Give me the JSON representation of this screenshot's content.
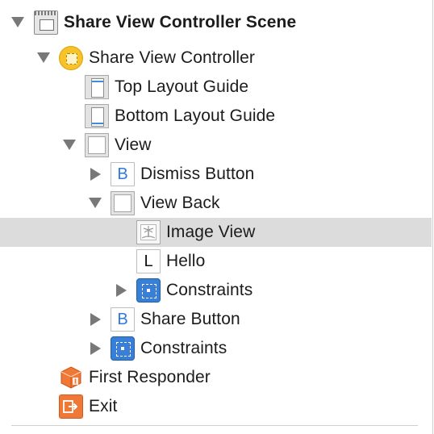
{
  "outline": {
    "scene": {
      "label": "Share View Controller Scene",
      "icon": "storyboard-scene-icon",
      "expanded": true
    },
    "items": [
      {
        "label": "Share View Controller",
        "icon": "view-controller-icon",
        "expanded": true
      },
      {
        "label": "Top Layout Guide",
        "icon": "top-layout-guide-icon"
      },
      {
        "label": "Bottom Layout Guide",
        "icon": "bottom-layout-guide-icon"
      },
      {
        "label": "View",
        "icon": "view-icon",
        "expanded": true
      },
      {
        "label": "Dismiss Button",
        "icon": "button-icon",
        "icon_letter": "B",
        "expanded": false
      },
      {
        "label": "View Back",
        "icon": "view-icon",
        "expanded": true
      },
      {
        "label": "Image View",
        "icon": "image-view-icon",
        "selected": true
      },
      {
        "label": "Hello",
        "icon": "label-icon",
        "icon_letter": "L"
      },
      {
        "label": "Constraints",
        "icon": "constraints-icon",
        "expanded": false
      },
      {
        "label": "Share Button",
        "icon": "button-icon",
        "icon_letter": "B",
        "expanded": false
      },
      {
        "label": "Constraints",
        "icon": "constraints-icon",
        "expanded": false
      },
      {
        "label": "First Responder",
        "icon": "first-responder-icon"
      },
      {
        "label": "Exit",
        "icon": "exit-icon"
      }
    ]
  },
  "colors": {
    "selection": "#dcdcdc",
    "accent_blue": "#2f7bd8",
    "vc_yellow": "#f7c326",
    "first_responder_orange": "#f07836"
  }
}
